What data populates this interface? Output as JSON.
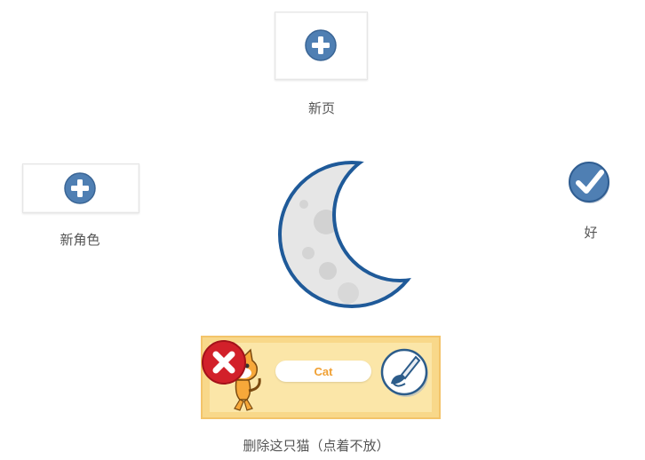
{
  "new_page": {
    "label": "新页",
    "icon": "plus-icon"
  },
  "new_sprite": {
    "label": "新角色",
    "icon": "plus-icon"
  },
  "ok": {
    "label": "好",
    "icon": "checkmark-icon"
  },
  "center": {
    "icon": "moon-icon"
  },
  "sprite": {
    "name": "Cat",
    "delete_icon": "delete-x-icon",
    "edit_icon": "paintbrush-icon",
    "character_icon": "cat-sprite-icon"
  },
  "delete_hint": "删除这只猫（点着不放）",
  "colors": {
    "accent_blue": "#4f7fb3",
    "moon_outline": "#1f5a99",
    "delete_red": "#d2202a",
    "card_yellow": "#fbe6a8",
    "name_orange": "#f0a033"
  }
}
